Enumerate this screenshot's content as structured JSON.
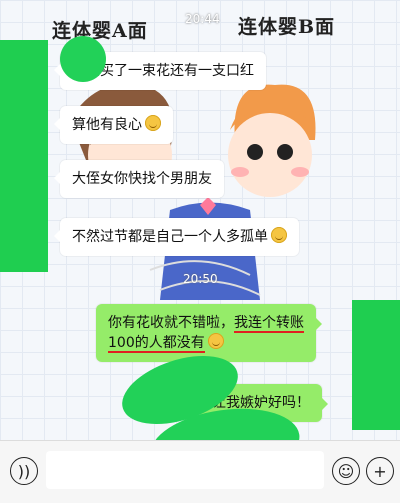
{
  "header": {
    "label_a": "连体婴A面",
    "label_b": "连体婴B面"
  },
  "timestamps": [
    "20:44",
    "20:50"
  ],
  "messages_a": [
    {
      "text": "给我买了一束花还有一支口红",
      "emoji": false
    },
    {
      "text": "算他有良心",
      "emoji": true
    },
    {
      "text": "大侄女你快找个男朋友",
      "emoji": false
    },
    {
      "text": "不然过节都是自己一个人多孤单",
      "emoji": true
    }
  ],
  "messages_b": [
    {
      "line1_plain": "你有花收就不错啦，",
      "line1_underlined": "我连个转账",
      "line2_underlined": "100的人都没有",
      "emoji": true
    },
    {
      "text": "让我嫉妒好吗！"
    }
  ],
  "colors": {
    "sent_bubble": "#95ec69",
    "received_bubble": "#ffffff",
    "censor_green": "#1fce50",
    "underline_red": "#e02020"
  },
  "icons": [
    "voice-icon",
    "emoji-icon",
    "plus-icon"
  ]
}
